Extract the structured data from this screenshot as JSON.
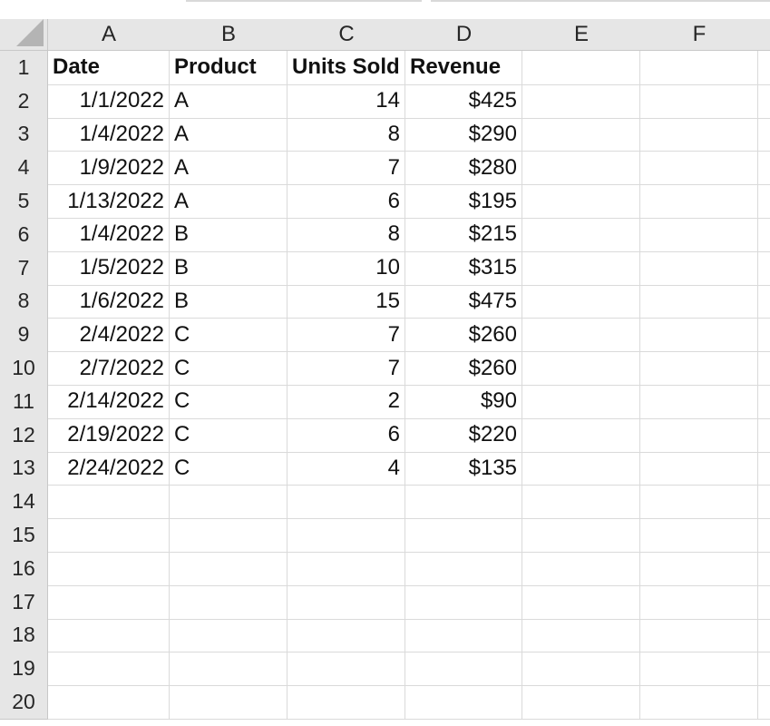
{
  "columns": [
    "A",
    "B",
    "C",
    "D",
    "E",
    "F"
  ],
  "rows": [
    "1",
    "2",
    "3",
    "4",
    "5",
    "6",
    "7",
    "8",
    "9",
    "10",
    "11",
    "12",
    "13",
    "14",
    "15",
    "16",
    "17",
    "18",
    "19",
    "20"
  ],
  "header_row": [
    "Date",
    "Product",
    "Units Sold",
    "Revenue"
  ],
  "data_rows": [
    [
      "1/1/2022",
      "A",
      "14",
      "$425"
    ],
    [
      "1/4/2022",
      "A",
      "8",
      "$290"
    ],
    [
      "1/9/2022",
      "A",
      "7",
      "$280"
    ],
    [
      "1/13/2022",
      "A",
      "6",
      "$195"
    ],
    [
      "1/4/2022",
      "B",
      "8",
      "$215"
    ],
    [
      "1/5/2022",
      "B",
      "10",
      "$315"
    ],
    [
      "1/6/2022",
      "B",
      "15",
      "$475"
    ],
    [
      "2/4/2022",
      "C",
      "7",
      "$260"
    ],
    [
      "2/7/2022",
      "C",
      "7",
      "$260"
    ],
    [
      "2/14/2022",
      "C",
      "2",
      "$90"
    ],
    [
      "2/19/2022",
      "C",
      "6",
      "$220"
    ],
    [
      "2/24/2022",
      "C",
      "4",
      "$135"
    ]
  ]
}
